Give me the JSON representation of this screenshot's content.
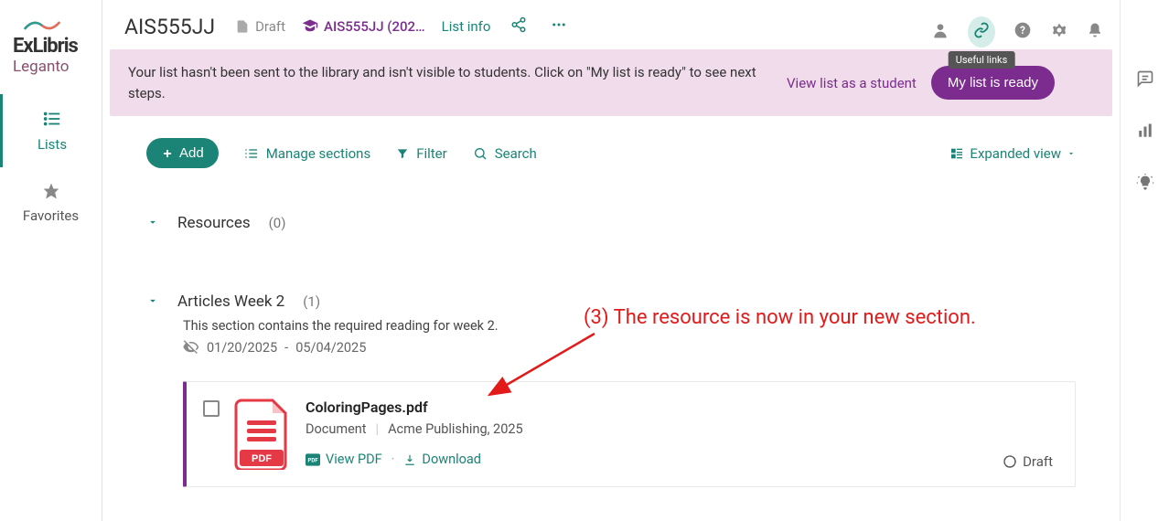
{
  "brand": {
    "name": "ExLibris",
    "sub": "Leganto"
  },
  "nav": {
    "lists": "Lists",
    "favorites": "Favorites"
  },
  "header": {
    "title": "AIS555JJ",
    "draft": "Draft",
    "course": "AIS555JJ (202…",
    "listInfo": "List info"
  },
  "tooltip": "Useful links",
  "banner": {
    "text": "Your list hasn't been sent to the library and isn't visible to students. Click on \"My list is ready\" to see next steps.",
    "viewAsStudent": "View list as a student",
    "readyBtn": "My list is ready"
  },
  "toolbar": {
    "add": "Add",
    "manage": "Manage sections",
    "filter": "Filter",
    "search": "Search",
    "viewMode": "Expanded view"
  },
  "sections": [
    {
      "title": "Resources",
      "count": "(0)"
    },
    {
      "title": "Articles Week 2",
      "count": "(1)",
      "desc": "This section contains the required reading for week 2.",
      "dateStart": "01/20/2025",
      "dateSep": "-",
      "dateEnd": "05/04/2025"
    }
  ],
  "resource": {
    "title": "ColoringPages.pdf",
    "type": "Document",
    "publisher": "Acme Publishing, 2025",
    "viewPdf": "View PDF",
    "download": "Download",
    "status": "Draft"
  },
  "annotation": "(3) The resource is now in your new section."
}
